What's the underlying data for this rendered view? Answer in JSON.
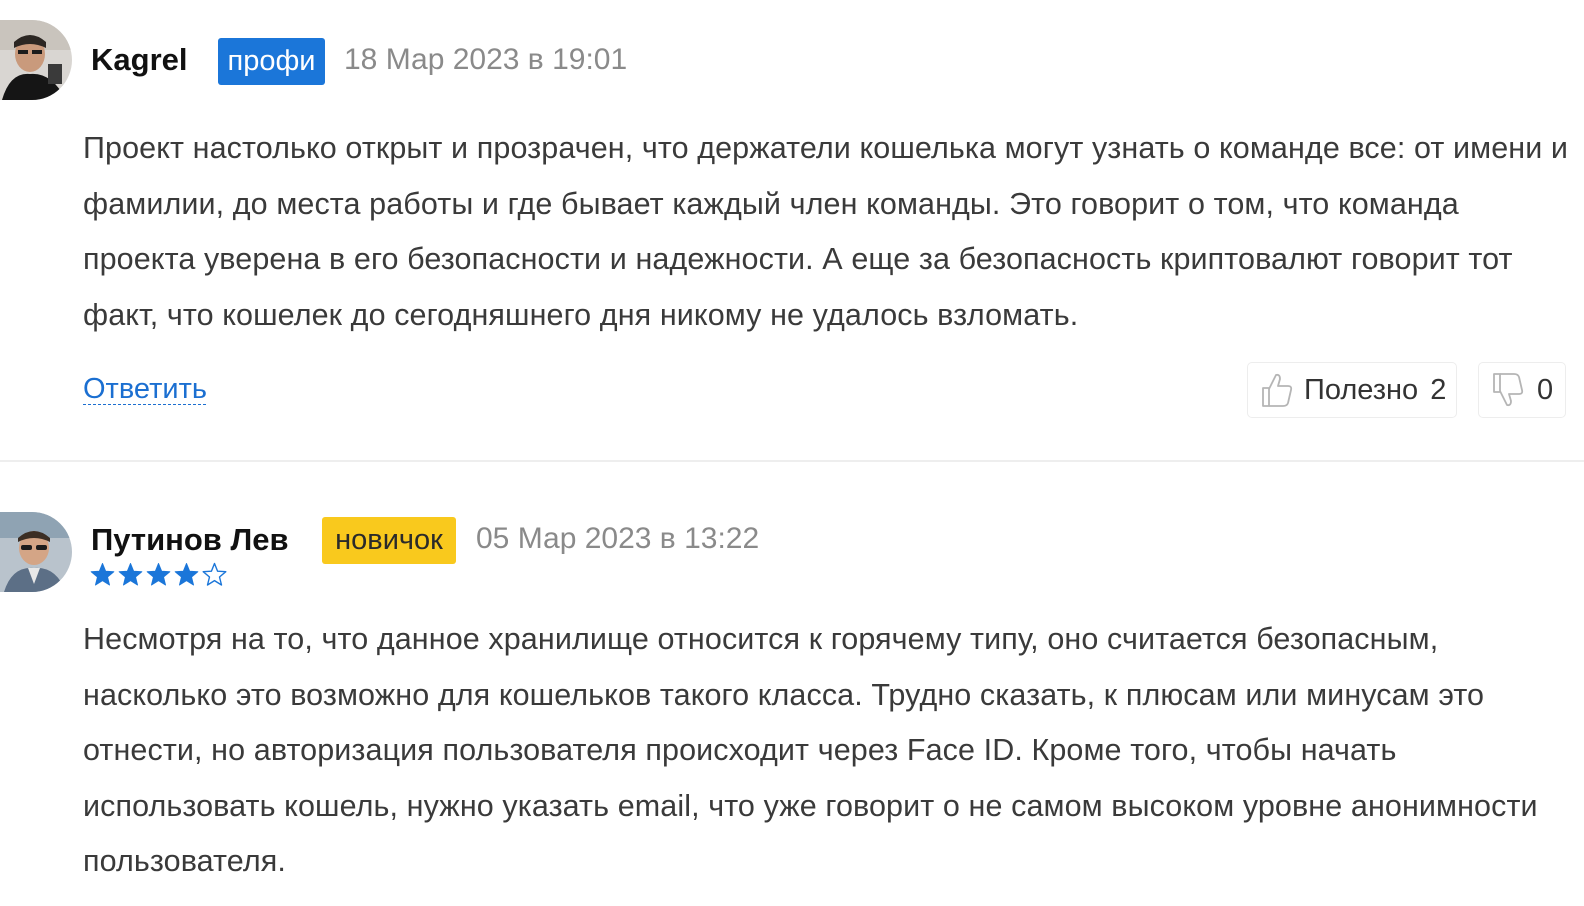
{
  "reviews": [
    {
      "author": "Kagrel",
      "badge": "профи",
      "date": "18 Мар 2023 в 19:01",
      "text": "Проект настолько открыт и прозрачен, что держатели кошелька могут узнать о команде все: от имени и фамилии, до места работы и где бывает каждый член команды. Это говорит о том, что команда проекта уверена в его безопасности и надежности. А еще за безопасность криптовалют говорит тот факт, что кошелек до сегодняшнего дня никому не удалось взломать.",
      "reply_label": "Ответить",
      "helpful_label": "Полезно",
      "helpful_count": "2",
      "unhelpful_count": "0"
    },
    {
      "author": "Путинов Лев",
      "badge": "новичок",
      "date": "05 Мар 2023 в 13:22",
      "rating": 4,
      "rating_max": 5,
      "text": "Несмотря на то, что данное хранилище относится к горячему типу, оно считается безопасным, насколько это возможно для кошельков такого класса. Трудно сказать, к плюсам или минусам это отнести, но авторизация пользователя происходит через Face ID. Кроме того, чтобы начать использовать кошель, нужно указать email, что уже говорит о не самом высоком уровне анонимности пользователя."
    }
  ],
  "colors": {
    "badge_pro": "#1b76d9",
    "badge_novice": "#f9c91d",
    "link": "#1b6fd1",
    "star": "#1b76d9"
  },
  "icons": {
    "thumbs_up": "thumbs-up-icon",
    "thumbs_down": "thumbs-down-icon",
    "star_filled": "star-filled-icon",
    "star_empty": "star-empty-icon"
  }
}
